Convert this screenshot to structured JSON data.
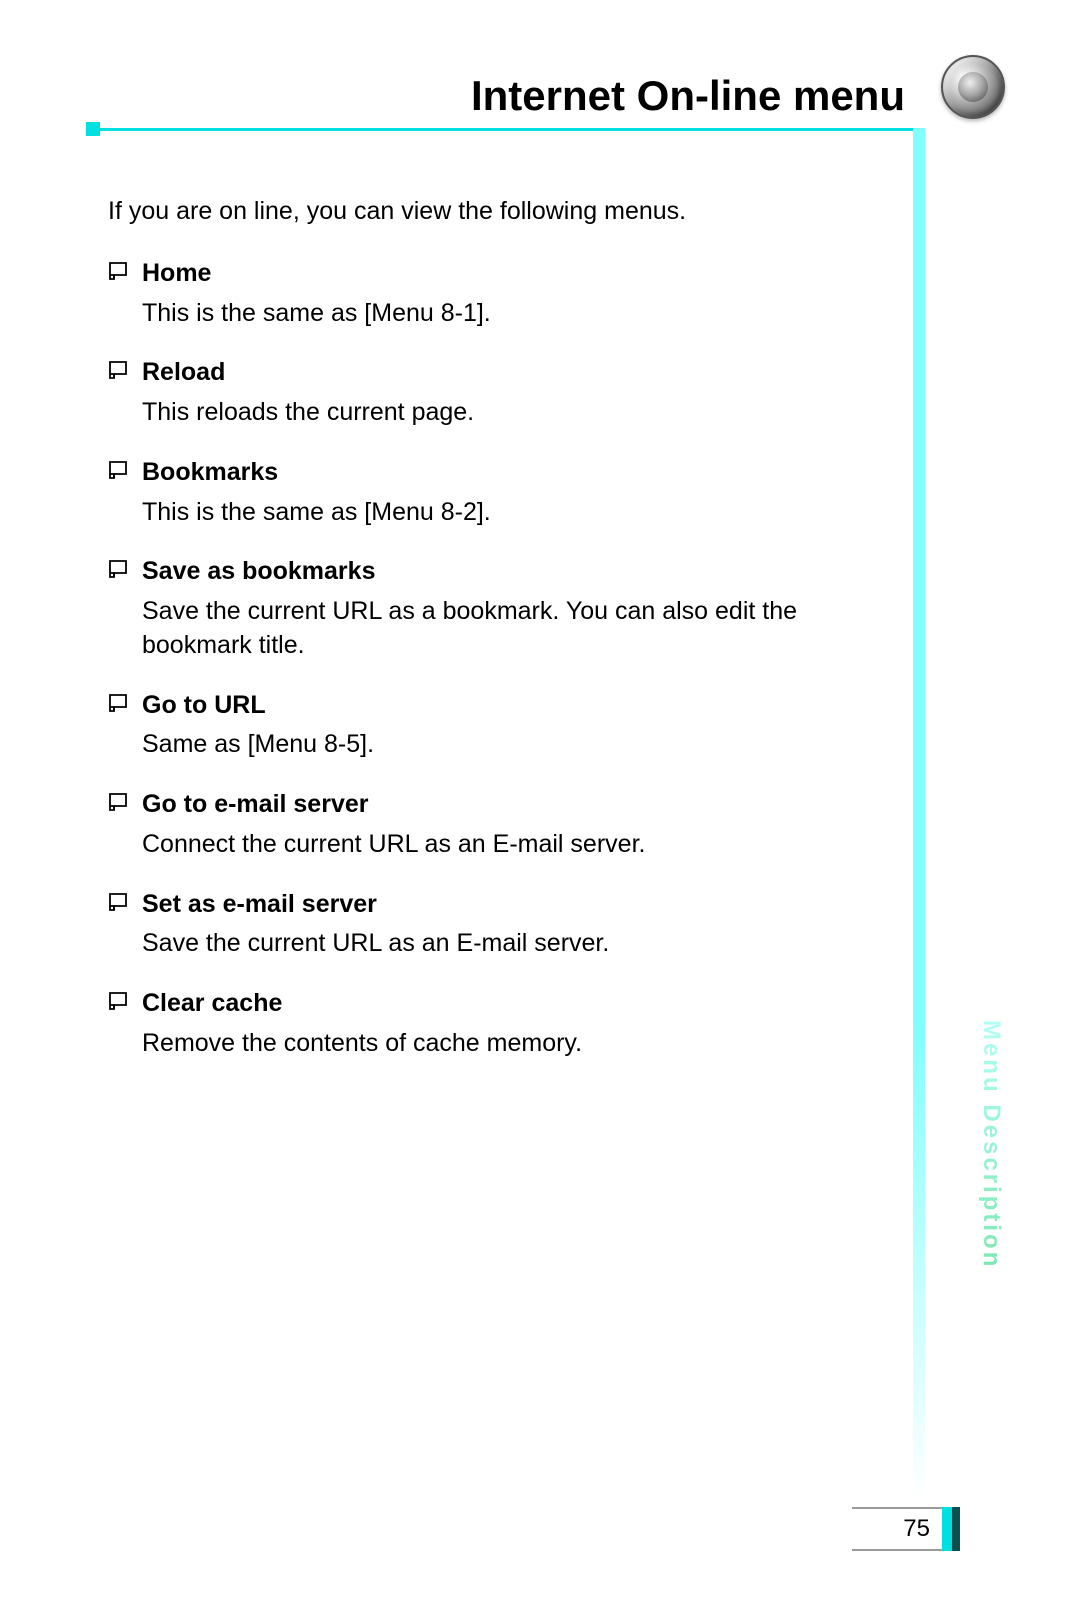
{
  "title": "Internet On-line menu",
  "intro": "If you are on line, you can view the following menus.",
  "items": [
    {
      "heading": "Home",
      "description": "This is the same as [Menu 8-1]."
    },
    {
      "heading": "Reload",
      "description": "This reloads the current page."
    },
    {
      "heading": "Bookmarks",
      "description": "This is the same as [Menu 8-2]."
    },
    {
      "heading": "Save as bookmarks",
      "description": "Save the current URL as a bookmark. You can also edit the bookmark title."
    },
    {
      "heading": "Go to URL",
      "description": "Same as [Menu 8-5]."
    },
    {
      "heading": "Go to e-mail server",
      "description": "Connect the current URL as an E-mail server."
    },
    {
      "heading": "Set as e-mail server",
      "description": "Save the current URL as an E-mail server."
    },
    {
      "heading": "Clear cache",
      "description": "Remove the contents of cache memory."
    }
  ],
  "side_label": "Menu Description",
  "page_number": "75"
}
